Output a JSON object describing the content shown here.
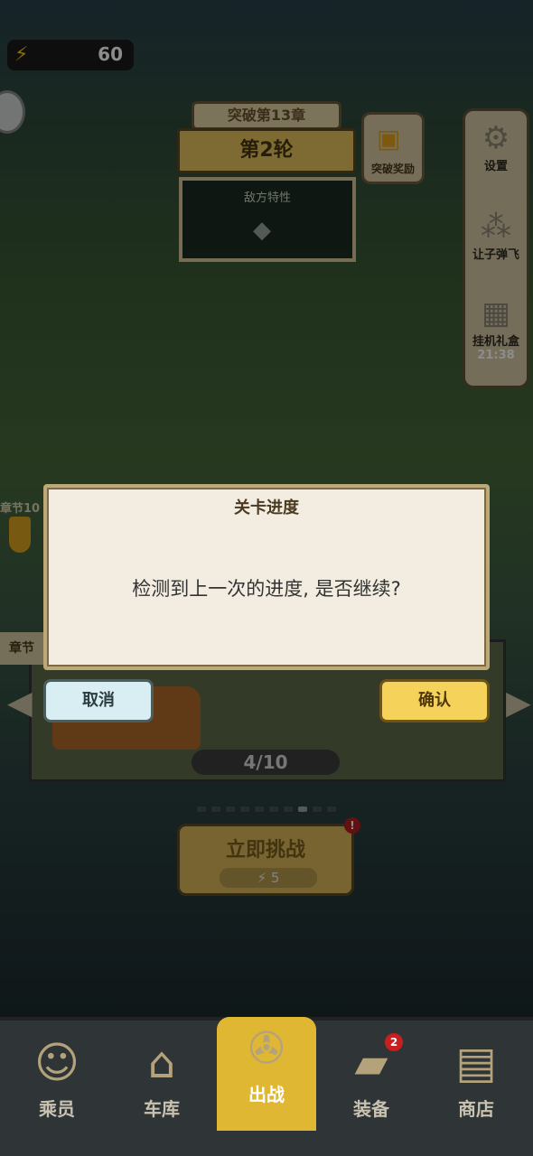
{
  "top": {
    "energy_value": "60"
  },
  "chapter": {
    "title": "突破第13章",
    "round": "第2轮",
    "enemy_traits_title": "敌方特性",
    "breakthrough_reward": "突破奖励",
    "left_chapter_label": "章节10",
    "left_tab_label": "章节",
    "progress": "4/10"
  },
  "side_menu": {
    "settings": "设置",
    "bullets": "让子弹飞",
    "idle_gift": "挂机礼盒",
    "idle_gift_timer": "21:38"
  },
  "challenge": {
    "label": "立即挑战",
    "cost": "5"
  },
  "dialog": {
    "title": "关卡进度",
    "message": "检测到上一次的进度, 是否继续?",
    "cancel": "取消",
    "confirm": "确认"
  },
  "nav": {
    "crew": "乘员",
    "garage": "车库",
    "battle": "出战",
    "equipment": "装备",
    "equipment_badge": "2",
    "shop": "商店"
  },
  "colors": {
    "accent_gold": "#e0b733",
    "dialog_bg": "#f2ede0",
    "confirm_bg": "#f5d35a",
    "cancel_bg": "#d8eef2"
  }
}
